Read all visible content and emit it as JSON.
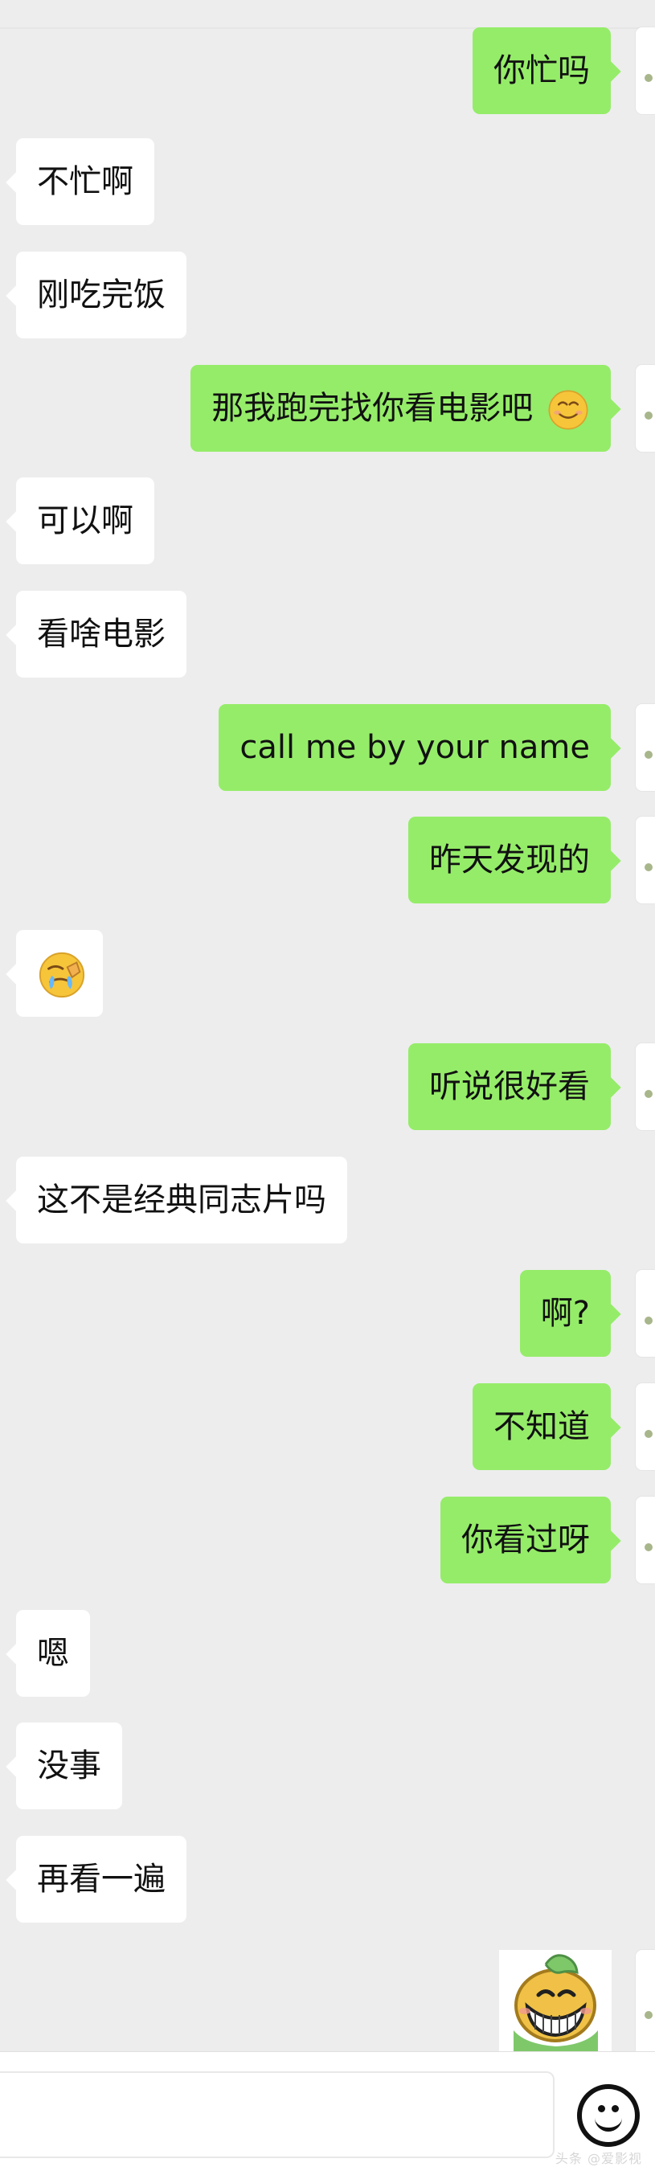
{
  "messages": [
    {
      "text": "你忙吗"
    },
    {
      "text": "不忙啊"
    },
    {
      "text": "刚吃完饭"
    },
    {
      "text": "那我跑完找你看电影吧"
    },
    {
      "text": "可以啊"
    },
    {
      "text": "看啥电影"
    },
    {
      "text": "call me by your name"
    },
    {
      "text": "昨天发现的"
    },
    {
      "text": ""
    },
    {
      "text": "听说很好看"
    },
    {
      "text": "这不是经典同志片吗"
    },
    {
      "text": "啊?"
    },
    {
      "text": "不知道"
    },
    {
      "text": "你看过呀"
    },
    {
      "text": "嗯"
    },
    {
      "text": "没事"
    },
    {
      "text": "再看一遍"
    }
  ],
  "icons": {
    "inline_emoji": "smile-emoji-icon",
    "facepalm": "facepalm-emoji-icon",
    "sticker": "grin-sticker-icon",
    "input_emoji": "emoji-button-icon"
  },
  "watermark": {
    "text": "头条 @爱影视"
  }
}
